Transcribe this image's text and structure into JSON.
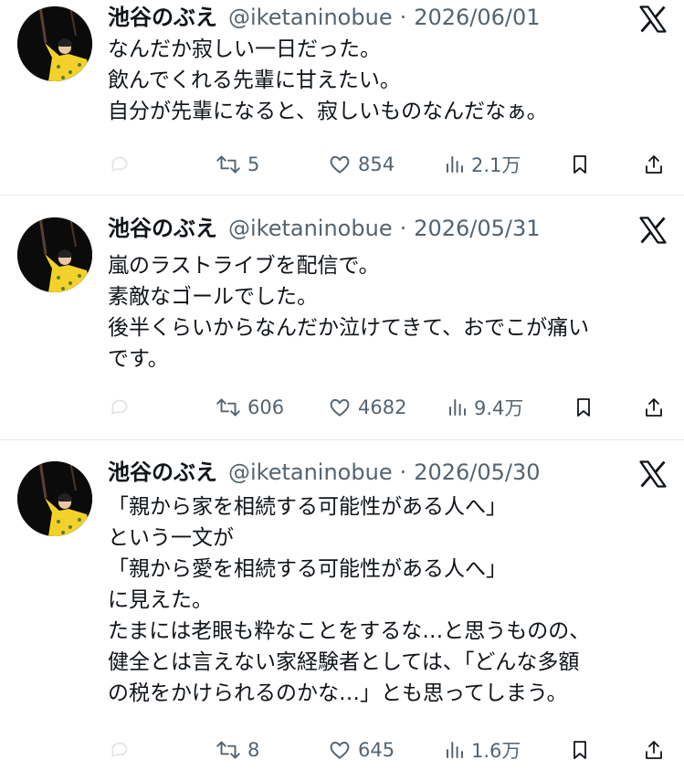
{
  "colors": {
    "text": "#0f1419",
    "muted": "#536471",
    "divider": "#e6e9ec",
    "avatar_outfit": "#f2d22a"
  },
  "tweets": [
    {
      "name": "池谷のぶえ",
      "handle": "@iketaninobue",
      "separator": "·",
      "date": "2026/06/01",
      "lines": [
        "なんだか寂しい一日だった。",
        "飲んでくれる先輩に甘えたい。",
        "自分が先輩になると、寂しいものなんだなぁ。"
      ],
      "retweets": "5",
      "likes": "854",
      "views": "2.1万"
    },
    {
      "name": "池谷のぶえ",
      "handle": "@iketaninobue",
      "separator": "·",
      "date": "2026/05/31",
      "lines": [
        "嵐のラストライブを配信で。",
        "素敵なゴールでした。",
        "後半くらいからなんだか泣けてきて、おでこが痛い",
        "です。"
      ],
      "retweets": "606",
      "likes": "4682",
      "views": "9.4万"
    },
    {
      "name": "池谷のぶえ",
      "handle": "@iketaninobue",
      "separator": "·",
      "date": "2026/05/30",
      "lines": [
        "「親から家を相続する可能性がある人へ」",
        "という一文が",
        "「親から愛を相続する可能性がある人へ」",
        "に見えた。",
        "たまには老眼も粋なことをするな…と思うものの、",
        "健全とは言えない家経験者としては、「どんな多額",
        "の税をかけられるのかな…」とも思ってしまう。"
      ],
      "retweets": "8",
      "likes": "645",
      "views": "1.6万"
    }
  ],
  "icons": [
    "reply-icon",
    "retweet-icon",
    "like-icon",
    "views-icon",
    "bookmark-icon",
    "share-icon",
    "x-logo-icon"
  ]
}
